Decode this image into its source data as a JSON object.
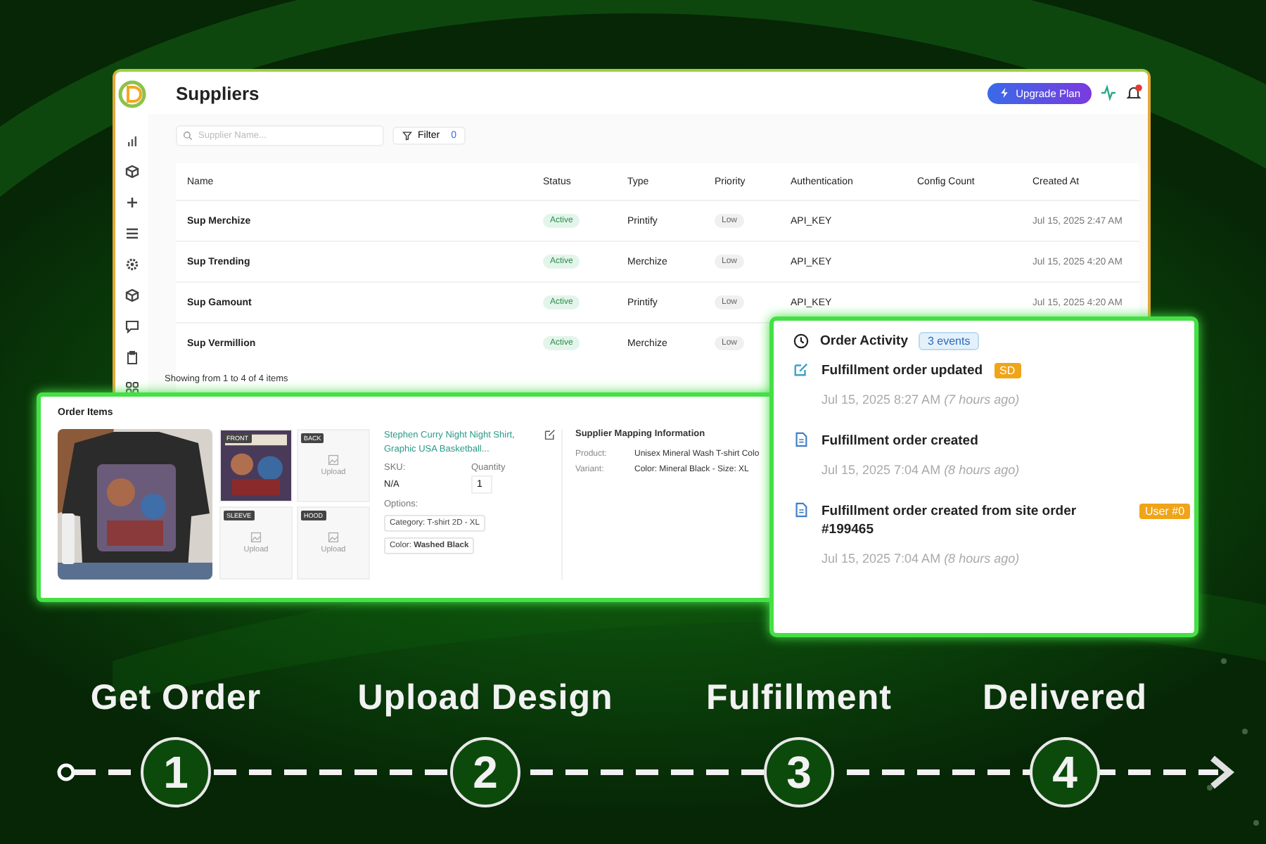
{
  "suppliers_window": {
    "title": "Suppliers",
    "upgrade_button": "Upgrade Plan",
    "search": {
      "placeholder": "Supplier Name..."
    },
    "filter": {
      "label": "Filter",
      "count": "0"
    },
    "columns": [
      "Name",
      "Status",
      "Type",
      "Priority",
      "Authentication",
      "Config Count",
      "Created At"
    ],
    "rows": [
      {
        "name": "Sup Merchize",
        "status": "Active",
        "type": "Printify",
        "priority": "Low",
        "authentication": "API_KEY",
        "created_at": "Jul 15, 2025 2:47 AM"
      },
      {
        "name": "Sup Trending",
        "status": "Active",
        "type": "Merchize",
        "priority": "Low",
        "authentication": "API_KEY",
        "created_at": "Jul 15, 2025 4:20 AM"
      },
      {
        "name": "Sup Gamount",
        "status": "Active",
        "type": "Printify",
        "priority": "Low",
        "authentication": "API_KEY",
        "created_at": "Jul 15, 2025 4:20 AM"
      },
      {
        "name": "Sup Vermillion",
        "status": "Active",
        "type": "Merchize",
        "priority": "Low"
      }
    ],
    "footer": "Showing from 1 to 4 of 4 items"
  },
  "order_items": {
    "title": "Order Items",
    "slots": [
      {
        "label": "FRONT",
        "kind": "picture"
      },
      {
        "label": "BACK",
        "kind": "upload",
        "action": "Upload"
      },
      {
        "label": "SLEEVE",
        "kind": "upload",
        "action": "Upload"
      },
      {
        "label": "HOOD",
        "kind": "upload",
        "action": "Upload"
      }
    ],
    "product": "Stephen Curry Night Night Shirt, Graphic USA Basketball...",
    "sku_label": "SKU:",
    "sku": "N/A",
    "quantity_label": "Quantity",
    "quantity": "1",
    "options_label": "Options:",
    "options": [
      "Category: T-shirt 2D - XL",
      "Color: **Washed Black**"
    ],
    "mapping": {
      "title": "Supplier Mapping Information",
      "fields": [
        {
          "label": "Product:",
          "value": "Unisex Mineral Wash T-shirt Colo"
        },
        {
          "label": "Variant:",
          "value": "Color: Mineral Black - Size: XL"
        }
      ]
    }
  },
  "order_activity": {
    "title": "Order Activity",
    "count": "3 events",
    "events": [
      {
        "kind": "edit",
        "title": "Fulfillment order updated",
        "badge": "SD",
        "time": "Jul 15, 2025 8:27 AM  *(7 hours ago)*"
      },
      {
        "kind": "document",
        "title": "Fulfillment order created",
        "time": "Jul 15, 2025 7:04 AM  *(8 hours ago)*"
      },
      {
        "kind": "document",
        "title": "Fulfillment order created from site order #199465",
        "badge": "User #0",
        "time": "Jul 15, 2025 7:04 AM  *(8 hours ago)*"
      }
    ]
  },
  "steps": [
    {
      "label": "Get Order",
      "number": "1"
    },
    {
      "label": "Upload Design",
      "number": "2"
    },
    {
      "label": "Fulfillment",
      "number": "3"
    },
    {
      "label": "Delivered",
      "number": "4"
    }
  ]
}
